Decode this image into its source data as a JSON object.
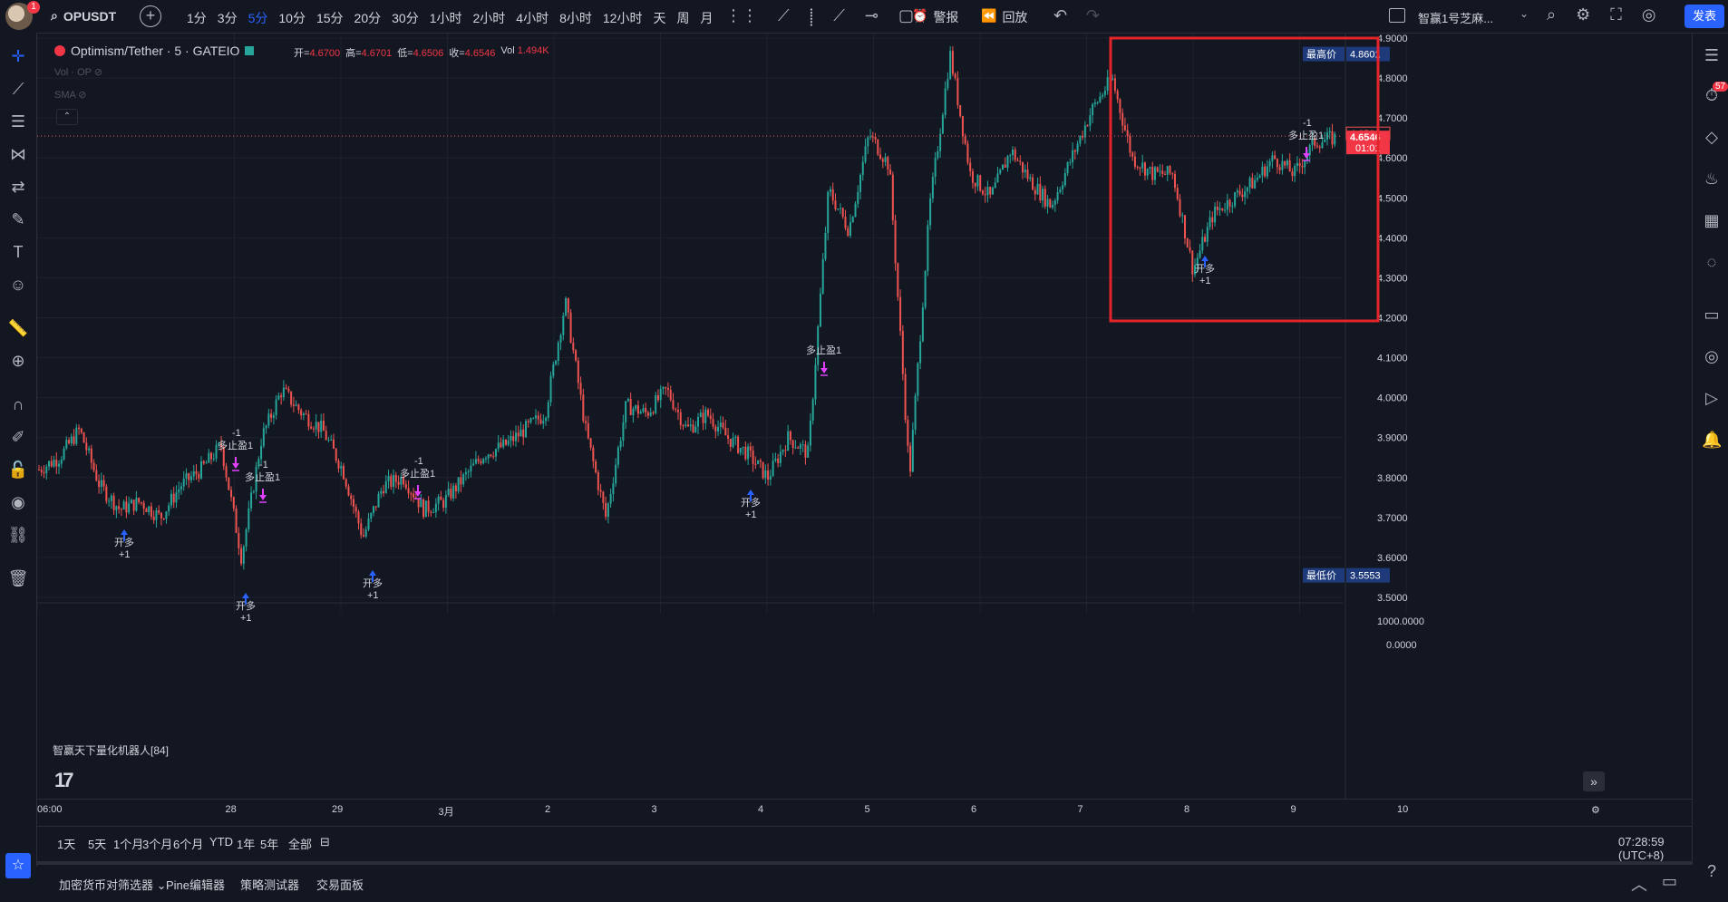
{
  "topbar": {
    "notification_count": "1",
    "symbol": "OPUSDT",
    "intervals": [
      "1分",
      "3分",
      "5分",
      "10分",
      "15分",
      "20分",
      "30分",
      "1小时",
      "2小时",
      "4小时",
      "8小时",
      "12小时",
      "天",
      "周",
      "月"
    ],
    "active_interval": "5分",
    "alert_label": "警报",
    "replay_label": "回放",
    "layout_name": "智赢1号芝麻...",
    "publish_label": "发表"
  },
  "legend": {
    "title": "Optimism/Tether · 5 · GATEIO",
    "open_label": "开=",
    "open": "4.6700",
    "high_label": "高=",
    "high": "4.6701",
    "low_label": "低=",
    "low": "4.6506",
    "close_label": "收=",
    "close": "4.6546",
    "vol_label": "Vol",
    "vol": "1.494K",
    "vol_indicator": "Vol · OP",
    "sma_indicator": "SMA"
  },
  "price_axis": {
    "labels": [
      "4.9000",
      "4.8000",
      "4.7000",
      "4.6000",
      "4.5000",
      "4.4000",
      "4.3000",
      "4.2000",
      "4.1000",
      "4.0000",
      "3.9000",
      "3.8000",
      "3.7000",
      "3.6000",
      "3.5000"
    ],
    "high_tag_label": "最高价",
    "high_tag_value": "4.8601",
    "low_tag_label": "最低价",
    "low_tag_value": "3.5553",
    "prev_price": "4.6590",
    "current_price": "4.6546",
    "countdown": "01:01",
    "vol_axis_top": "1000.0000",
    "vol_axis_bottom": "0.0000"
  },
  "chart_data": {
    "type": "candlestick",
    "x_labels": [
      "06:00",
      "28",
      "29",
      "3月",
      "2",
      "3",
      "4",
      "5",
      "6",
      "7",
      "8",
      "9",
      "10"
    ],
    "ylim": [
      3.5,
      4.9
    ],
    "approx_close_path": [
      3.82,
      3.85,
      3.92,
      3.78,
      3.72,
      3.74,
      3.7,
      3.78,
      3.82,
      3.88,
      3.6,
      3.9,
      4.02,
      3.96,
      3.92,
      3.82,
      3.65,
      3.78,
      3.8,
      3.72,
      3.74,
      3.8,
      3.86,
      3.88,
      3.92,
      3.96,
      4.24,
      3.92,
      3.7,
      3.98,
      3.96,
      4.02,
      3.92,
      3.96,
      3.9,
      3.86,
      3.8,
      3.9,
      3.86,
      4.52,
      4.42,
      4.66,
      4.58,
      3.8,
      4.48,
      4.86,
      4.56,
      4.5,
      4.62,
      4.54,
      4.48,
      4.6,
      4.72,
      4.8,
      4.6,
      4.56,
      4.56,
      4.32,
      4.46,
      4.5,
      4.54,
      4.6,
      4.56,
      4.64,
      4.65
    ],
    "signals": [
      {
        "type": "buy",
        "label": "开多",
        "qty": "+1"
      },
      {
        "type": "sell",
        "label": "多止盈1",
        "qty": "-1"
      },
      {
        "type": "sell",
        "label": "多止盈1",
        "qty": "-1"
      },
      {
        "type": "buy",
        "label": "开多",
        "qty": "+1"
      },
      {
        "type": "buy",
        "label": "开多",
        "qty": "+1"
      },
      {
        "type": "sell",
        "label": "多止盈1",
        "qty": "-1"
      },
      {
        "type": "buy",
        "label": "开多",
        "qty": "+1"
      },
      {
        "type": "sell",
        "label": "多止盈1",
        "qty": ""
      },
      {
        "type": "buy",
        "label": "开多",
        "qty": "+1"
      },
      {
        "type": "sell",
        "label": "多止盈1",
        "qty": "-1"
      }
    ]
  },
  "indicator_name": "智赢天下量化机器人[84]",
  "range_buttons": [
    "1天",
    "5天",
    "1个月",
    "3个月",
    "6个月",
    "YTD",
    "1年",
    "5年",
    "全部"
  ],
  "clock": "07:28:59 (UTC+8)",
  "bottom_tabs": [
    "加密货币对筛选器",
    "Pine编辑器",
    "策略测试器",
    "交易面板"
  ],
  "right_badge": "57",
  "colors": {
    "up": "#26a69a",
    "down": "#ef5350",
    "accent": "#2962ff",
    "highlight": "#f23645",
    "signal_buy": "#2962ff",
    "signal_sell": "#e040fb"
  }
}
